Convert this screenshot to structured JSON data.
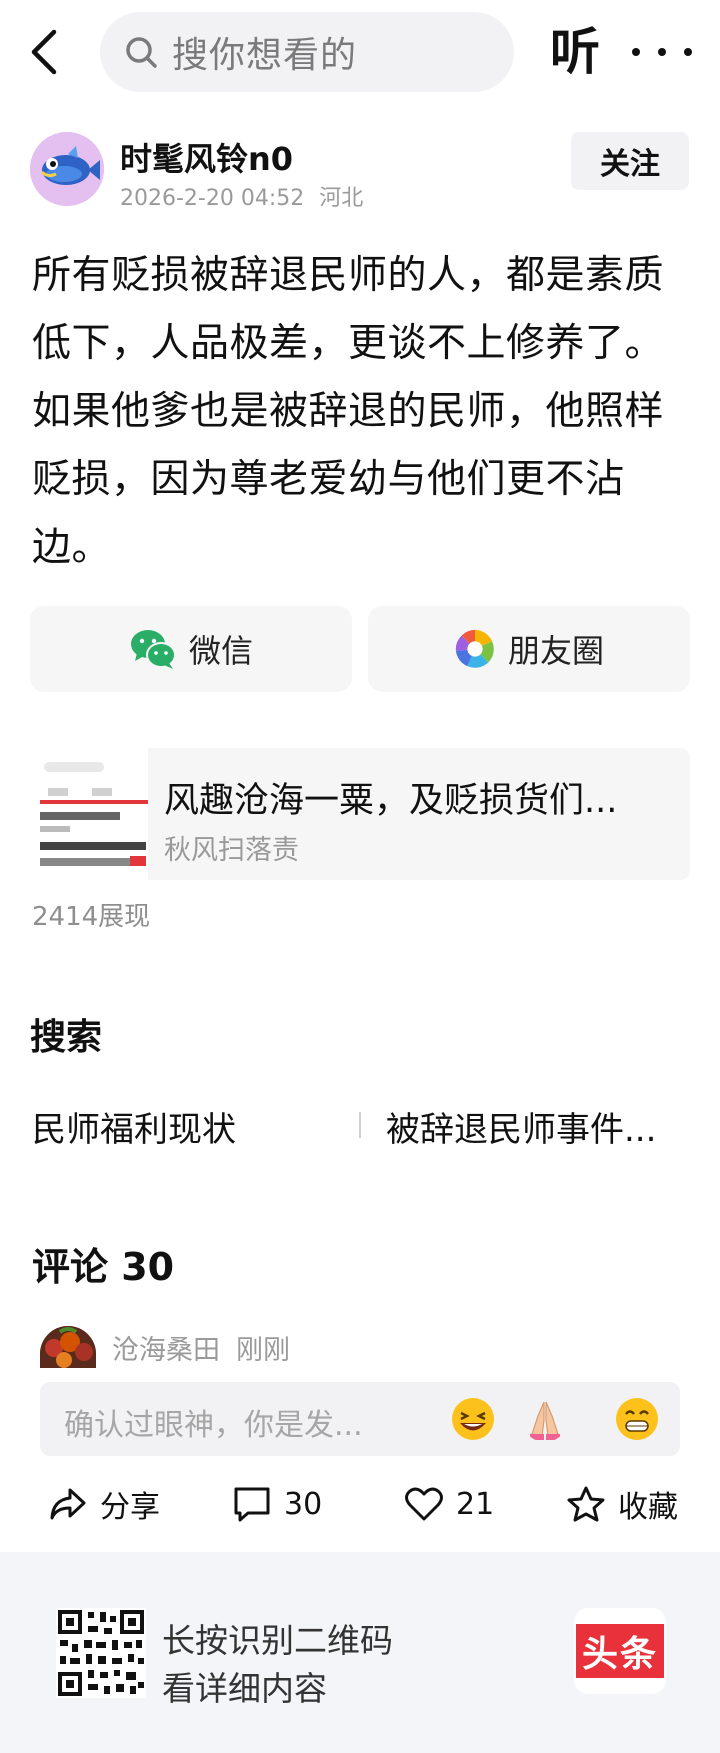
{
  "topbar": {
    "search_placeholder": "搜你想看的",
    "listen_label": "听"
  },
  "author": {
    "name": "时髦风铃n0",
    "datetime": "2026-2-20 04:52",
    "location": "河北",
    "follow_label": "关注"
  },
  "post": {
    "text": "所有贬损被辞退民师的人，都是素质低下，人品极差，更谈不上修养了。如果他爹也是被辞退的民师，他照样贬损，因为尊老爱幼与他们更不沾边。"
  },
  "share": {
    "wechat_label": "微信",
    "moments_label": "朋友圈"
  },
  "quoted": {
    "title": "风趣沧海一粟，及贬损货们...",
    "author": "秋风扫落责"
  },
  "views": "2414展现",
  "search_section": {
    "title": "搜索",
    "suggestions": [
      "民师福利现状",
      "被辞退民师事件..."
    ]
  },
  "comments": {
    "title": "评论 30",
    "first": {
      "user": "沧海桑田",
      "time": "刚刚"
    },
    "input_placeholder": "确认过眼神，你是发..."
  },
  "actions": {
    "share_label": "分享",
    "comment_count": "30",
    "like_count": "21",
    "favorite_label": "收藏"
  },
  "footer": {
    "line1": "长按识别二维码",
    "line2": "看详细内容",
    "logo_text": "头条"
  },
  "colors": {
    "wechat_green": "#2aae67",
    "brand_red": "#e8313a",
    "muted_text": "#9a9a9a"
  }
}
